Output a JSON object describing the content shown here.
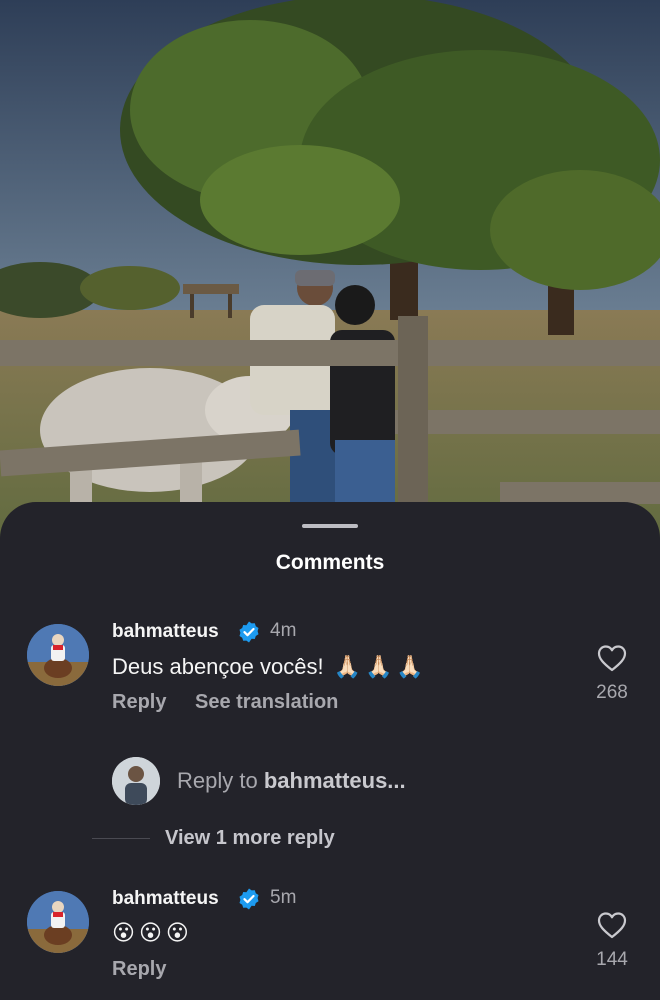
{
  "sheet": {
    "title": "Comments"
  },
  "comments": [
    {
      "username": "bahmatteus",
      "verified": true,
      "time": "4m",
      "text": "Deus abençoe vocês!",
      "emojis": [
        "🙏🏻",
        "🙏🏻",
        "🙏🏻"
      ],
      "actions": [
        "Reply",
        "See translation"
      ],
      "likes": "268"
    },
    {
      "username": "bahmatteus",
      "verified": true,
      "time": "5m",
      "text": "",
      "emojis": [
        "😮",
        "😮",
        "😮"
      ],
      "actions": [
        "Reply"
      ],
      "likes": "144"
    }
  ],
  "reply_box": {
    "prefix": "Reply to ",
    "target": "bahmatteus..."
  },
  "view_more": "View 1 more reply",
  "colors": {
    "sheet_bg": "#23232a",
    "verified_blue": "#1d9bf0",
    "secondary_text": "#a8a8ae"
  },
  "icons": [
    "verified-badge-icon",
    "heart-outline-icon"
  ]
}
